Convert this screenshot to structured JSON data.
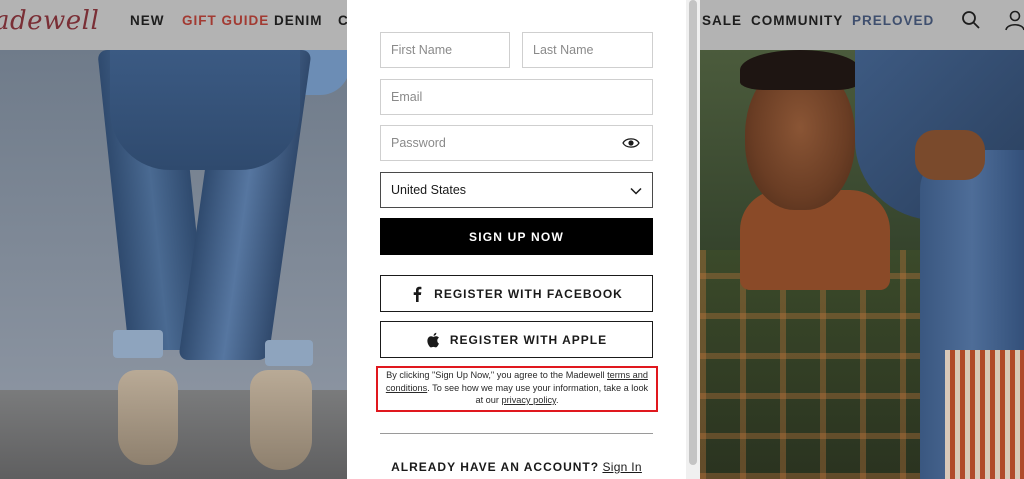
{
  "nav": {
    "logo": "adewell",
    "items": [
      "NEW",
      "GIFT GUIDE",
      "DENIM",
      "C",
      "SALE",
      "COMMUNITY",
      "PRELOVED"
    ]
  },
  "form": {
    "first_name_placeholder": "First Name",
    "last_name_placeholder": "Last Name",
    "email_placeholder": "Email",
    "password_placeholder": "Password",
    "country_value": "United States",
    "signup_label": "SIGN UP NOW",
    "facebook_label": "REGISTER WITH FACEBOOK",
    "apple_label": "REGISTER WITH APPLE",
    "legal": {
      "part1": "By clicking \"Sign Up Now,\" you agree to the Madewell ",
      "terms_link": "terms and conditions",
      "part2": ". To see how we may use your information, take a look at our ",
      "privacy_link": "privacy policy",
      "part3": "."
    },
    "already_question": "ALREADY HAVE AN ACCOUNT?",
    "signin_link": "Sign In"
  },
  "colors": {
    "highlight_box": "#e0181e",
    "gift_guide": "#a23a32",
    "preloved": "#3f4f6e"
  }
}
